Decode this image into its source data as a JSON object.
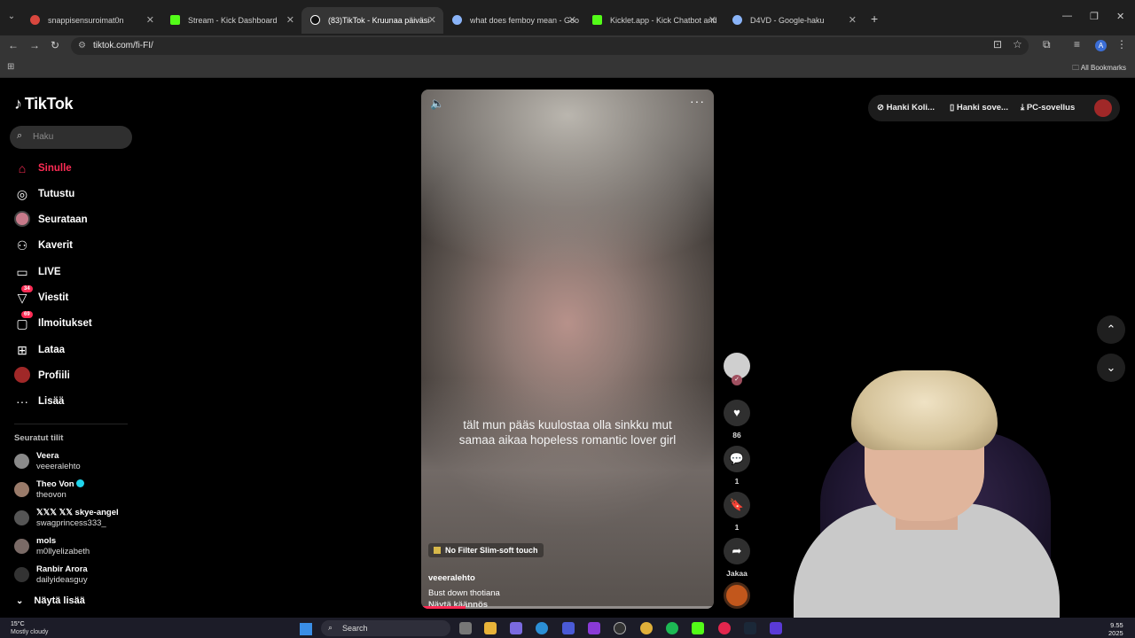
{
  "browser": {
    "tabs": [
      {
        "title": "snappisensuroimat0n",
        "active": false,
        "color": "#d9473e"
      },
      {
        "title": "Stream - Kick Dashboard",
        "active": false,
        "color": "#53fc18"
      },
      {
        "title": "(83)TikTok - Kruunaa päiväsi",
        "active": true,
        "color": "#ffffff"
      },
      {
        "title": "what does femboy mean - Goo",
        "active": false,
        "color": "#8ab4f8"
      },
      {
        "title": "Kicklet.app - Kick Chatbot and",
        "active": false,
        "color": "#53fc18"
      },
      {
        "title": "D4VD - Google-haku",
        "active": false,
        "color": "#8ab4f8"
      }
    ],
    "url": "tiktok.com/fi-FI/",
    "profile_initial": "A",
    "bookmarks_label": "All Bookmarks"
  },
  "tiktok": {
    "logo": "TikTok",
    "search_placeholder": "Haku",
    "nav": [
      {
        "label": "Sinulle",
        "icon": "home-icon",
        "glyph": "⌂",
        "active": true
      },
      {
        "label": "Tutustu",
        "icon": "compass-icon",
        "glyph": "◎"
      },
      {
        "label": "Seurataan",
        "icon": "following-avatar-icon",
        "glyph": ""
      },
      {
        "label": "Kaverit",
        "icon": "friends-icon",
        "glyph": "👥"
      },
      {
        "label": "LIVE",
        "icon": "live-icon",
        "glyph": "▭"
      },
      {
        "label": "Viestit",
        "icon": "messages-icon",
        "glyph": "▽",
        "badge": "34"
      },
      {
        "label": "Ilmoitukset",
        "icon": "notifications-icon",
        "glyph": "▢",
        "badge": "69"
      },
      {
        "label": "Lataa",
        "icon": "upload-icon",
        "glyph": "⊞"
      },
      {
        "label": "Profiili",
        "icon": "profile-avatar-icon",
        "glyph": ""
      },
      {
        "label": "Lisää",
        "icon": "more-icon",
        "glyph": "···"
      }
    ],
    "followed_title": "Seuratut tilit",
    "followed": [
      {
        "name": "Veera",
        "username": "veeeralehto",
        "verified": false
      },
      {
        "name": "Theo Von",
        "username": "theovon",
        "verified": true
      },
      {
        "name": "𝕏𝕏𝕏 𝕏𝕏 skye-angel",
        "username": "swagprincess333_",
        "verified": false
      },
      {
        "name": "mols",
        "username": "m0llyelizabeth",
        "verified": false
      },
      {
        "name": "Ranbir Arora",
        "username": "dailyideasguy",
        "verified": false
      }
    ],
    "show_more": "Näytä lisää",
    "video": {
      "caption": "tält mun pääs kuulostaa olla sinkku mut samaa aikaa hopeless romantic lover girl",
      "effect": "No Filter Slim-soft touch",
      "author": "veeeralehto",
      "description": "Bust down thotiana",
      "translate": "Näytä käännös",
      "progress": 0.15
    },
    "actions": {
      "likes": "86",
      "comments": "1",
      "saves": "1",
      "share_label": "Jakaa"
    },
    "topbar": {
      "coins": "Hanki Koli...",
      "app": "Hanki sove...",
      "pc": "PC-sovellus"
    }
  },
  "taskbar": {
    "temp": "15°C",
    "weather": "Mostly cloudy",
    "search": "Search",
    "time": "9.55",
    "date": "2025"
  },
  "colors": {
    "accent": "#fe2c55",
    "background": "#000000",
    "chrome": "#1f1f1f"
  }
}
